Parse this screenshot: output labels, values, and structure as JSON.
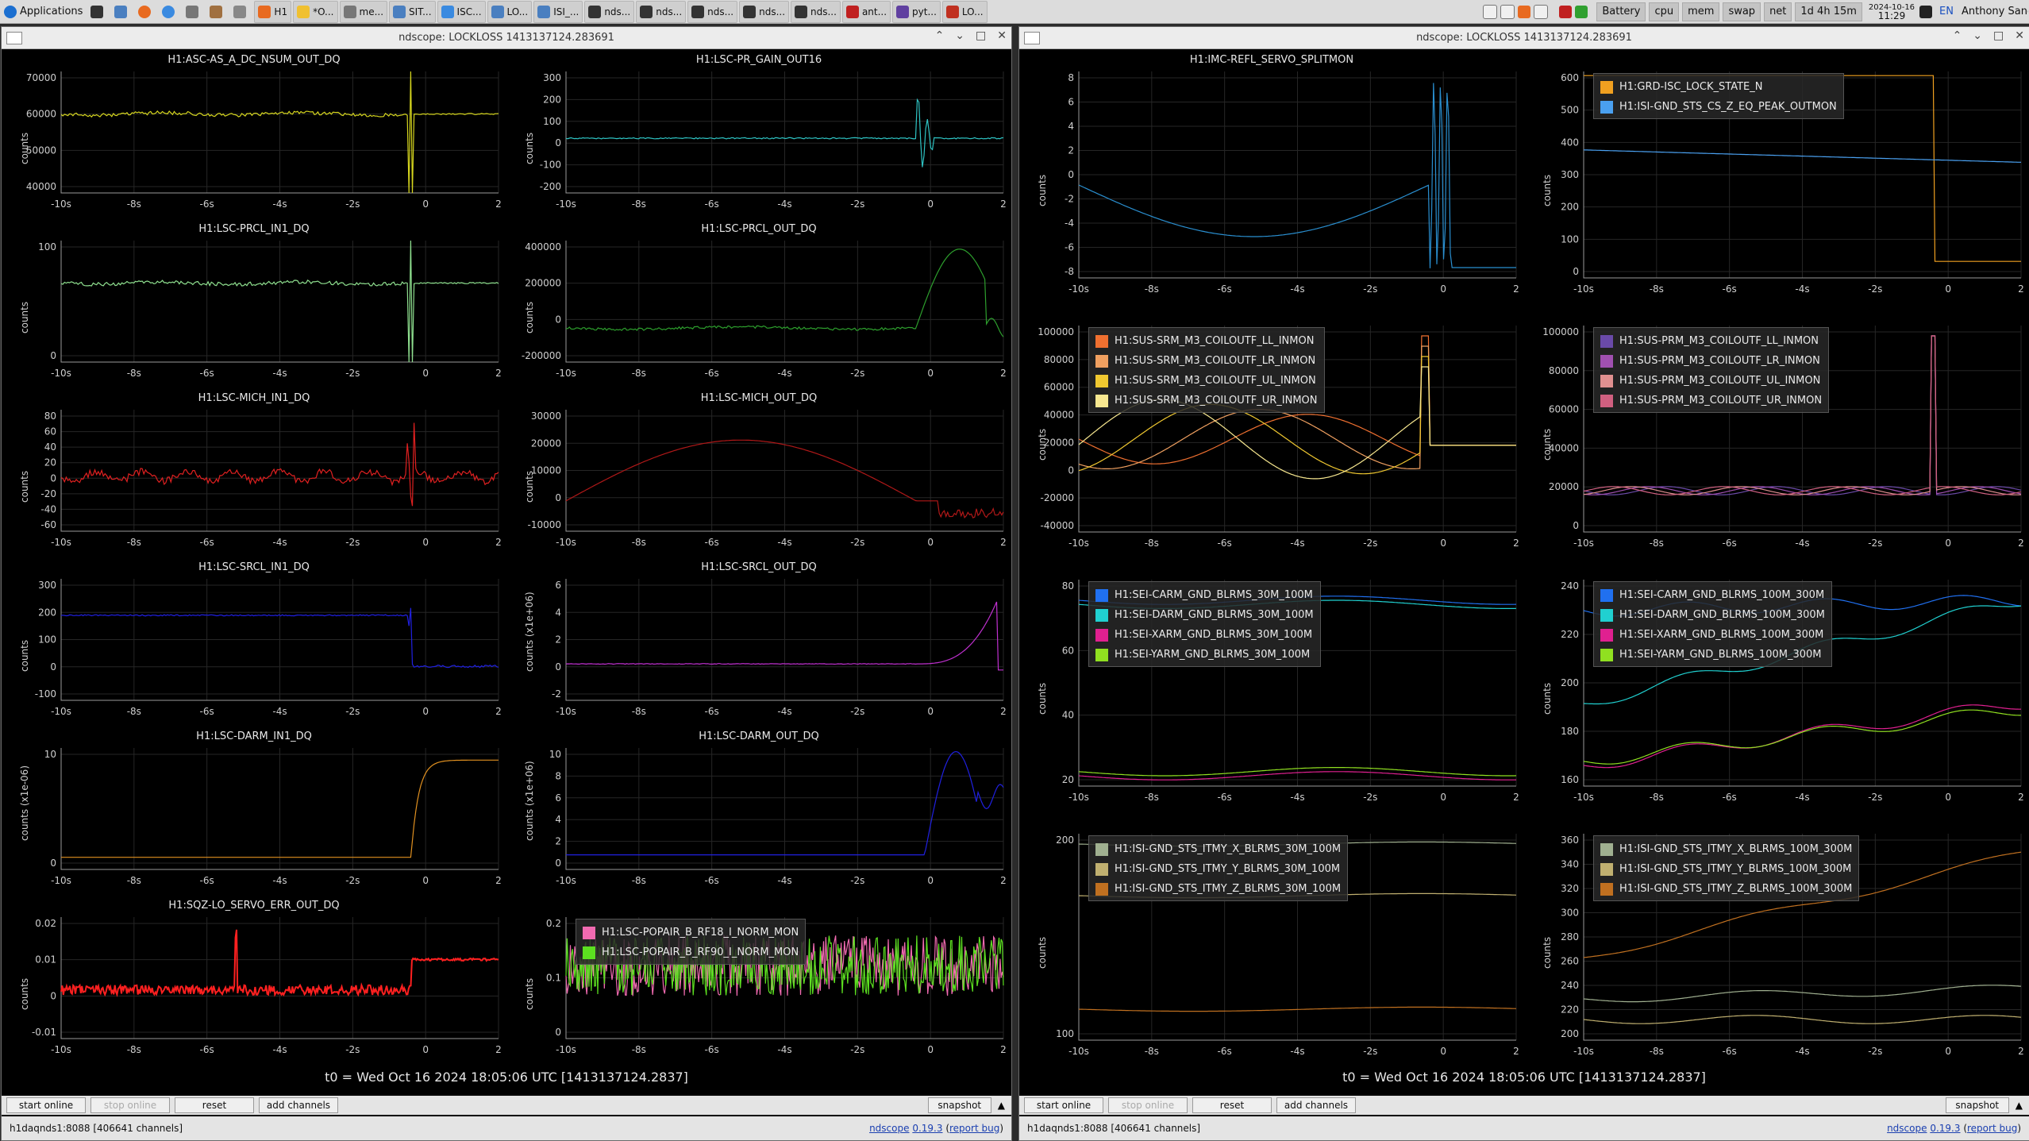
{
  "taskbar": {
    "applications": "Applications",
    "tasks": [
      "H1",
      "*O...",
      "me...",
      "SIT...",
      "ISC...",
      "LO...",
      "ISI_...",
      "nds...",
      "nds...",
      "nds...",
      "nds...",
      "nds...",
      "ant...",
      "pyt...",
      "LO..."
    ],
    "indicators": [
      "Battery",
      "cpu",
      "mem",
      "swap",
      "net"
    ],
    "uptime": "1d 4h 15m",
    "date": "2024-10-16",
    "time": "11:29",
    "lang": "EN",
    "user": "Anthony Sanchez"
  },
  "windows": [
    {
      "title": "ndscope: LOCKLOSS 1413137124.283691",
      "t0": "t0 = Wed Oct 16 2024 18:05:06 UTC [1413137124.2837]",
      "buttons": {
        "start_online": "start online",
        "stop_online": "stop online",
        "reset": "reset",
        "add_channels": "add channels",
        "snapshot": "snapshot"
      },
      "status_left": "h1daqnds1:8088  [406641 channels]",
      "status_ndscope": "ndscope",
      "status_version": "0.19.3",
      "status_report": "report bug",
      "plots": [
        {
          "title": "H1:ASC-AS_A_DC_NSUM_OUT_DQ",
          "ylabel": "counts",
          "yticks": [
            "70000",
            "60000",
            "50000",
            "40000"
          ],
          "xticks": [
            "-10s",
            "-8s",
            "-6s",
            "-4s",
            "-2s",
            "0",
            "2"
          ],
          "shape": "flat-spike",
          "color": "#d6d61e",
          "series": []
        },
        {
          "title": "H1:LSC-PR_GAIN_OUT16",
          "ylabel": "counts",
          "yticks": [
            "300",
            "200",
            "100",
            "0",
            "-100",
            "-200"
          ],
          "xticks": [
            "-10s",
            "-8s",
            "-6s",
            "-4s",
            "-2s",
            "0",
            "2"
          ],
          "shape": "flat-oscillate",
          "color": "#2ec4c4",
          "series": []
        },
        {
          "title": "H1:LSC-PRCL_IN1_DQ",
          "ylabel": "counts",
          "yticks": [
            "100",
            "0"
          ],
          "xticks": [
            "-10s",
            "-8s",
            "-6s",
            "-4s",
            "-2s",
            "0",
            "2"
          ],
          "shape": "flat-spike",
          "color": "#8fe08f",
          "series": []
        },
        {
          "title": "H1:LSC-PRCL_OUT_DQ",
          "ylabel": "counts",
          "yticks": [
            "400000",
            "200000",
            "0",
            "-200000"
          ],
          "xticks": [
            "-10s",
            "-8s",
            "-6s",
            "-4s",
            "-2s",
            "0",
            "2"
          ],
          "shape": "flat-hump",
          "color": "#2d9f2d",
          "series": []
        },
        {
          "title": "H1:LSC-MICH_IN1_DQ",
          "ylabel": "counts",
          "yticks": [
            "80",
            "60",
            "40",
            "20",
            "0",
            "-20",
            "-40",
            "-60"
          ],
          "xticks": [
            "-10s",
            "-8s",
            "-6s",
            "-4s",
            "-2s",
            "0",
            "2"
          ],
          "shape": "noisy-spike",
          "color": "#e02020",
          "series": []
        },
        {
          "title": "H1:LSC-MICH_OUT_DQ",
          "ylabel": "counts",
          "yticks": [
            "30000",
            "20000",
            "10000",
            "0",
            "-10000"
          ],
          "xticks": [
            "-10s",
            "-8s",
            "-6s",
            "-4s",
            "-2s",
            "0",
            "2"
          ],
          "shape": "arch",
          "color": "#b01818",
          "series": []
        },
        {
          "title": "H1:LSC-SRCL_IN1_DQ",
          "ylabel": "counts",
          "yticks": [
            "300",
            "200",
            "100",
            "0",
            "-100"
          ],
          "xticks": [
            "-10s",
            "-8s",
            "-6s",
            "-4s",
            "-2s",
            "0",
            "2"
          ],
          "shape": "flat-drop",
          "color": "#2020e0",
          "series": []
        },
        {
          "title": "H1:LSC-SRCL_OUT_DQ",
          "ylabel": "counts (x1e+06)",
          "yticks": [
            "6",
            "4",
            "2",
            "0",
            "-2"
          ],
          "xticks": [
            "-10s",
            "-8s",
            "-6s",
            "-4s",
            "-2s",
            "0",
            "2"
          ],
          "shape": "flat-rise",
          "color": "#c030d0",
          "series": []
        },
        {
          "title": "H1:LSC-DARM_IN1_DQ",
          "ylabel": "counts (x1e-06)",
          "yticks": [
            "10",
            "0"
          ],
          "xticks": [
            "-10s",
            "-8s",
            "-6s",
            "-4s",
            "-2s",
            "0",
            "2"
          ],
          "shape": "step-up",
          "color": "#e09020",
          "series": []
        },
        {
          "title": "H1:LSC-DARM_OUT_DQ",
          "ylabel": "counts (x1e+06)",
          "yticks": [
            "10",
            "8",
            "6",
            "4",
            "2",
            "0"
          ],
          "xticks": [
            "-10s",
            "-8s",
            "-6s",
            "-4s",
            "-2s",
            "0",
            "2"
          ],
          "shape": "flat-peak",
          "color": "#2020e0",
          "series": []
        },
        {
          "title": "H1:SQZ-LO_SERVO_ERR_OUT_DQ",
          "ylabel": "counts",
          "yticks": [
            "0.02",
            "0.01",
            "0",
            "-0.01"
          ],
          "xticks": [
            "-10s",
            "-8s",
            "-6s",
            "-4s",
            "-2s",
            "0",
            "2"
          ],
          "shape": "thick-noise",
          "color": "#ff2020",
          "series": []
        },
        {
          "title": "",
          "ylabel": "counts",
          "yticks": [
            "0.2",
            "0.1",
            "0"
          ],
          "xticks": [
            "-10s",
            "-8s",
            "-6s",
            "-4s",
            "-2s",
            "0",
            "2"
          ],
          "shape": "two-noise",
          "color": "#8ee020",
          "series": [
            {
              "name": "H1:LSC-POPAIR_B_RF18_I_NORM_MON",
              "color": "#f06ab0"
            },
            {
              "name": "H1:LSC-POPAIR_B_RF90_I_NORM_MON",
              "color": "#5ce020"
            }
          ]
        }
      ]
    },
    {
      "title": "ndscope: LOCKLOSS 1413137124.283691",
      "t0": "t0 = Wed Oct 16 2024 18:05:06 UTC [1413137124.2837]",
      "buttons": {
        "start_online": "start online",
        "stop_online": "stop online",
        "reset": "reset",
        "add_channels": "add channels",
        "snapshot": "snapshot"
      },
      "status_left": "h1daqnds1:8088  [406641 channels]",
      "status_ndscope": "ndscope",
      "status_version": "0.19.3",
      "status_report": "report bug",
      "plots": [
        {
          "title": "H1:IMC-REFL_SERVO_SPLITMON",
          "ylabel": "counts",
          "yticks": [
            "8",
            "6",
            "4",
            "2",
            "0",
            "-2",
            "-4",
            "-6",
            "-8"
          ],
          "xticks": [
            "-10s",
            "-8s",
            "-6s",
            "-4s",
            "-2s",
            "0",
            "2"
          ],
          "shape": "valley-oscillate",
          "color": "#2a8fd0",
          "series": []
        },
        {
          "title": "",
          "ylabel": "counts",
          "yticks": [
            "600",
            "500",
            "400",
            "300",
            "200",
            "100",
            "0"
          ],
          "xticks": [
            "-10s",
            "-8s",
            "-6s",
            "-4s",
            "-2s",
            "0",
            "2"
          ],
          "shape": "lockstate",
          "color": "#e0a030",
          "series": [
            {
              "name": "H1:GRD-ISC_LOCK_STATE_N",
              "color": "#f0a020"
            },
            {
              "name": "H1:ISI-GND_STS_CS_Z_EQ_PEAK_OUTMON",
              "color": "#4aa0f0"
            }
          ]
        },
        {
          "title": "",
          "ylabel": "counts",
          "yticks": [
            "100000",
            "80000",
            "60000",
            "40000",
            "20000",
            "0",
            "-20000",
            "-40000"
          ],
          "xticks": [
            "-10s",
            "-8s",
            "-6s",
            "-4s",
            "-2s",
            "0",
            "2"
          ],
          "shape": "multi-wave",
          "color": "#f08030",
          "series": [
            {
              "name": "H1:SUS-SRM_M3_COILOUTF_LL_INMON",
              "color": "#f07030"
            },
            {
              "name": "H1:SUS-SRM_M3_COILOUTF_LR_INMON",
              "color": "#f0a060"
            },
            {
              "name": "H1:SUS-SRM_M3_COILOUTF_UL_INMON",
              "color": "#f0c830"
            },
            {
              "name": "H1:SUS-SRM_M3_COILOUTF_UR_INMON",
              "color": "#f8e890"
            }
          ]
        },
        {
          "title": "",
          "ylabel": "counts",
          "yticks": [
            "100000",
            "80000",
            "60000",
            "40000",
            "20000",
            "0"
          ],
          "xticks": [
            "-10s",
            "-8s",
            "-6s",
            "-4s",
            "-2s",
            "0",
            "2"
          ],
          "shape": "multi-flat-spike",
          "color": "#c04080",
          "series": [
            {
              "name": "H1:SUS-PRM_M3_COILOUTF_LL_INMON",
              "color": "#6a4aa8"
            },
            {
              "name": "H1:SUS-PRM_M3_COILOUTF_LR_INMON",
              "color": "#a050b0"
            },
            {
              "name": "H1:SUS-PRM_M3_COILOUTF_UL_INMON",
              "color": "#e09090"
            },
            {
              "name": "H1:SUS-PRM_M3_COILOUTF_UR_INMON",
              "color": "#d06080"
            }
          ]
        },
        {
          "title": "",
          "ylabel": "counts",
          "yticks": [
            "80",
            "60",
            "40",
            "20"
          ],
          "xticks": [
            "-10s",
            "-8s",
            "-6s",
            "-4s",
            "-2s",
            "0",
            "2"
          ],
          "shape": "multi-level",
          "color": "#2a8fd0",
          "series": [
            {
              "name": "H1:SEI-CARM_GND_BLRMS_30M_100M",
              "color": "#2070f0"
            },
            {
              "name": "H1:SEI-DARM_GND_BLRMS_30M_100M",
              "color": "#20d0d0"
            },
            {
              "name": "H1:SEI-XARM_GND_BLRMS_30M_100M",
              "color": "#e02090"
            },
            {
              "name": "H1:SEI-YARM_GND_BLRMS_30M_100M",
              "color": "#90e020"
            }
          ]
        },
        {
          "title": "",
          "ylabel": "counts",
          "yticks": [
            "240",
            "220",
            "200",
            "180",
            "160"
          ],
          "xticks": [
            "-10s",
            "-8s",
            "-6s",
            "-4s",
            "-2s",
            "0",
            "2"
          ],
          "shape": "multi-rise",
          "color": "#20c0c0",
          "series": [
            {
              "name": "H1:SEI-CARM_GND_BLRMS_100M_300M",
              "color": "#2070f0"
            },
            {
              "name": "H1:SEI-DARM_GND_BLRMS_100M_300M",
              "color": "#20d0d0"
            },
            {
              "name": "H1:SEI-XARM_GND_BLRMS_100M_300M",
              "color": "#e02090"
            },
            {
              "name": "H1:SEI-YARM_GND_BLRMS_100M_300M",
              "color": "#90e020"
            }
          ]
        },
        {
          "title": "",
          "ylabel": "counts",
          "yticks": [
            "200",
            "100"
          ],
          "xticks": [
            "-10s",
            "-8s",
            "-6s",
            "-4s",
            "-2s",
            "0",
            "2"
          ],
          "shape": "multi-level2",
          "color": "#c08030",
          "series": [
            {
              "name": "H1:ISI-GND_STS_ITMY_X_BLRMS_30M_100M",
              "color": "#a0b090"
            },
            {
              "name": "H1:ISI-GND_STS_ITMY_Y_BLRMS_30M_100M",
              "color": "#c0b070"
            },
            {
              "name": "H1:ISI-GND_STS_ITMY_Z_BLRMS_30M_100M",
              "color": "#c07020"
            }
          ]
        },
        {
          "title": "",
          "ylabel": "counts",
          "yticks": [
            "360",
            "340",
            "320",
            "300",
            "280",
            "260",
            "240",
            "220",
            "200"
          ],
          "xticks": [
            "-10s",
            "-8s",
            "-6s",
            "-4s",
            "-2s",
            "0",
            "2"
          ],
          "shape": "multi-rise2",
          "color": "#c07020",
          "series": [
            {
              "name": "H1:ISI-GND_STS_ITMY_X_BLRMS_100M_300M",
              "color": "#a0b090"
            },
            {
              "name": "H1:ISI-GND_STS_ITMY_Y_BLRMS_100M_300M",
              "color": "#c0b070"
            },
            {
              "name": "H1:ISI-GND_STS_ITMY_Z_BLRMS_100M_300M",
              "color": "#c07020"
            }
          ]
        }
      ]
    }
  ]
}
